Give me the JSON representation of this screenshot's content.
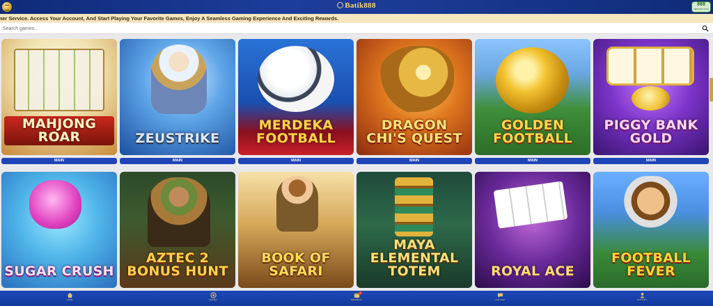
{
  "header": {
    "brand": "Batik888",
    "wallet_value": "888",
    "wallet_sub": "DEPOSIT NOW"
  },
  "marquee": {
    "text": "omer Service. Access Your Account, And Start Playing Your Favorite Games, Enjoy A Seamless Gaming Experience And Exciting Rewards."
  },
  "search": {
    "placeholder": "Search games..."
  },
  "games": [
    {
      "title": "MAHJONG ROAR",
      "tag": "MAIN"
    },
    {
      "title": "ZEUSTRIKE",
      "tag": "MAIN"
    },
    {
      "title": "MERDEKA FOOTBALL",
      "tag": "MAIN"
    },
    {
      "title": "DRAGON CHI'S QUEST",
      "tag": "MAIN"
    },
    {
      "title": "GOLDEN FOOTBALL",
      "tag": "MAIN"
    },
    {
      "title": "PIGGY BANK GOLD",
      "tag": "MAIN"
    },
    {
      "title": "SUGAR CRUSH"
    },
    {
      "title": "AZTEC 2 BONUS HUNT"
    },
    {
      "title": "BOOK OF SAFARI"
    },
    {
      "title": "MAYA ELEMENTAL TOTEM"
    },
    {
      "title": "ROYAL ACE"
    },
    {
      "title": "FOOTBALL FEVER"
    }
  ],
  "bottom_nav": [
    {
      "label": "HOME",
      "icon": "home-icon"
    },
    {
      "label": "PROMO",
      "icon": "gift-icon"
    },
    {
      "label": "REFERRAL",
      "icon": "referral-icon",
      "badge": "1"
    },
    {
      "label": "LIVE CHAT",
      "icon": "chat-icon"
    },
    {
      "label": "ACCOUNT",
      "icon": "account-icon"
    }
  ],
  "colors": {
    "header_bg": "#1a3a92",
    "accent_gold": "#f6d77a",
    "main_button": "#1f45b8",
    "marquee_bg": "#f4e6bf",
    "bottom_bar": "#1c48b5"
  }
}
